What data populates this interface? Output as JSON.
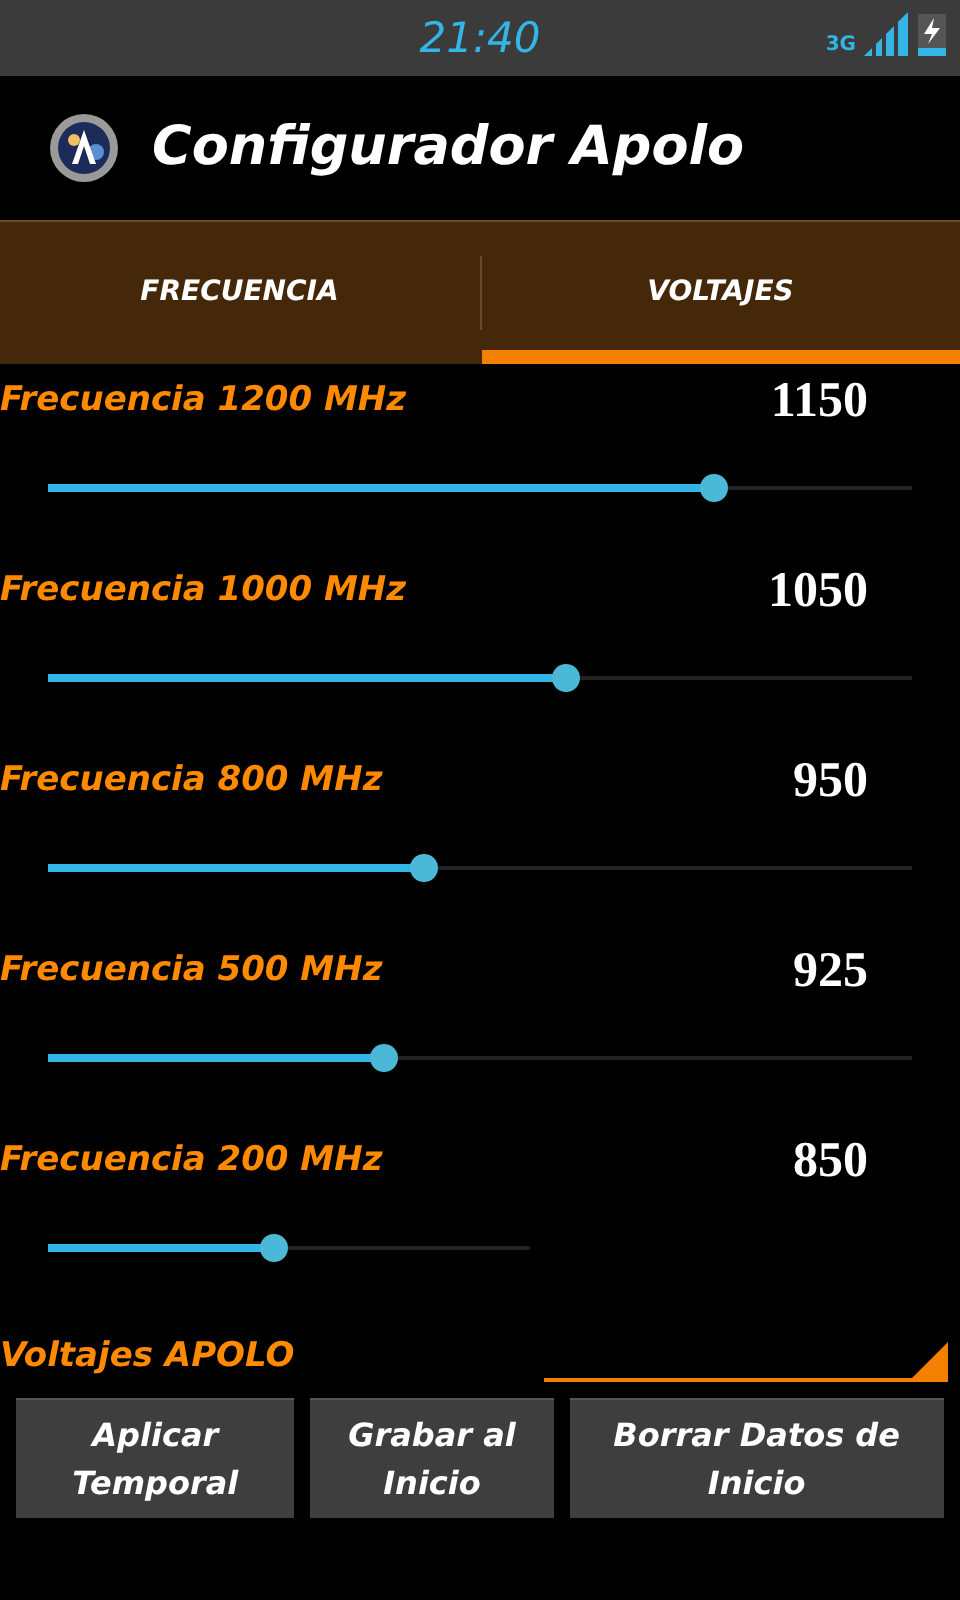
{
  "status_bar": {
    "time": "21:40",
    "network": "3G"
  },
  "app_bar": {
    "title": "Configurador Apolo"
  },
  "tabs": [
    {
      "label": "FRECUENCIA",
      "selected": false
    },
    {
      "label": "VOLTAJES",
      "selected": true
    }
  ],
  "sliders": [
    {
      "label": "Frecuencia 1200 MHz",
      "value": "1150",
      "level": 0.77,
      "kind": "wide"
    },
    {
      "label": "Frecuencia 1000 MHz",
      "value": "1050",
      "level": 0.6,
      "kind": "wide"
    },
    {
      "label": "Frecuencia 800 MHz",
      "value": "950",
      "level": 0.435,
      "kind": "wide"
    },
    {
      "label": "Frecuencia 500 MHz",
      "value": "925",
      "level": 0.39,
      "kind": "wide"
    },
    {
      "label": "Frecuencia 200 MHz",
      "value": "850",
      "level": 0.47,
      "kind": "narrow"
    }
  ],
  "profile": {
    "label": "Voltajes APOLO"
  },
  "buttons": [
    {
      "label": "Aplicar Temporal"
    },
    {
      "label": "Grabar al Inicio"
    },
    {
      "label": "Borrar Datos de Inicio"
    }
  ]
}
